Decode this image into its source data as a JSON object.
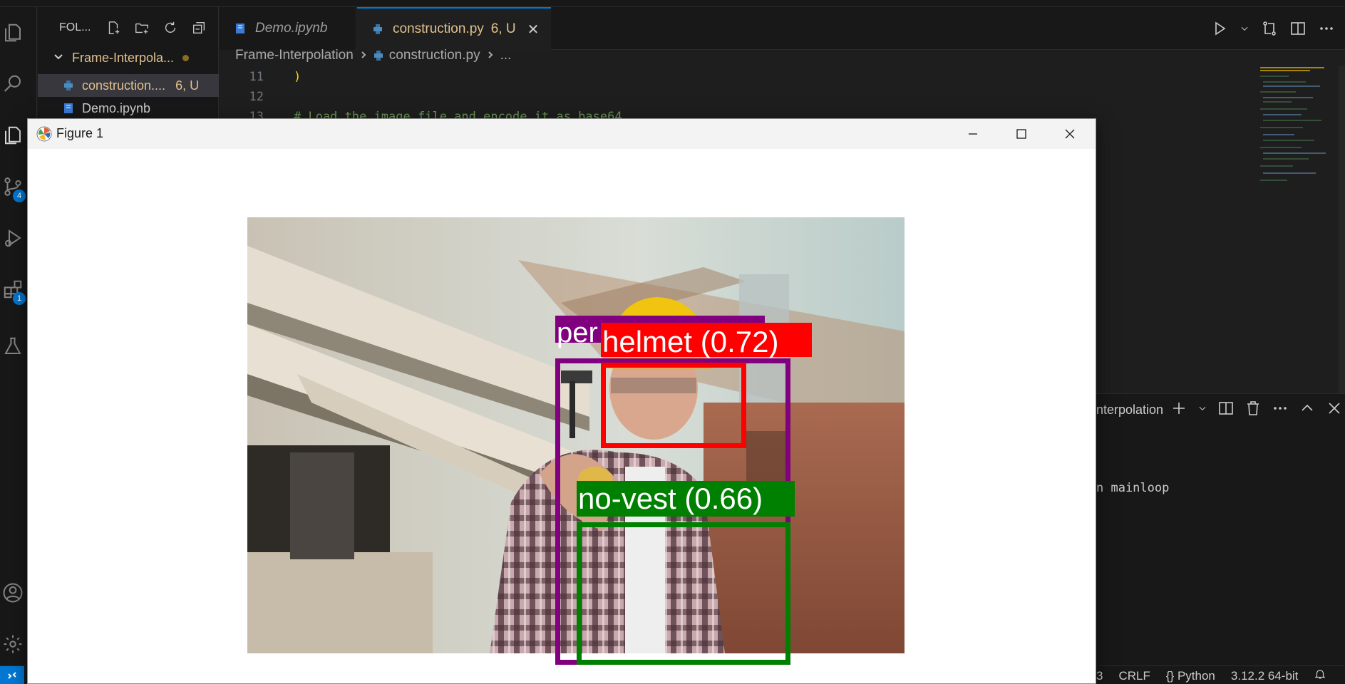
{
  "explorer": {
    "title": "FOL...",
    "folder": "Frame-Interpola...",
    "files": [
      {
        "name": "construction....",
        "status": "6, U"
      },
      {
        "name": "Demo.ipynb",
        "status": ""
      }
    ]
  },
  "activity": {
    "badges": {
      "source_control": "4",
      "extensions": "1"
    }
  },
  "tabs": [
    {
      "label": "Demo.ipynb"
    },
    {
      "label": "construction.py",
      "status": "6, U",
      "close": "✕"
    }
  ],
  "breadcrumb": {
    "items": [
      "Frame-Interpolation",
      "construction.py",
      "..."
    ]
  },
  "code": {
    "lines": [
      {
        "num": "11",
        "text": ")"
      },
      {
        "num": "12",
        "text": ""
      },
      {
        "num": "13",
        "text": "# Load the image file and encode it as base64"
      }
    ]
  },
  "figure": {
    "title": "Figure 1",
    "detections": [
      {
        "label": "per",
        "color": "#800080"
      },
      {
        "label": "helmet (0.72)",
        "color": "#ff0000"
      },
      {
        "label": "no-vest (0.66)",
        "color": "#008000"
      }
    ]
  },
  "panel": {
    "title": "nterpolation",
    "terminal_text": "n mainloop"
  },
  "statusbar": {
    "items": [
      "3",
      "CRLF",
      "{} Python",
      "3.12.2 64-bit"
    ]
  }
}
